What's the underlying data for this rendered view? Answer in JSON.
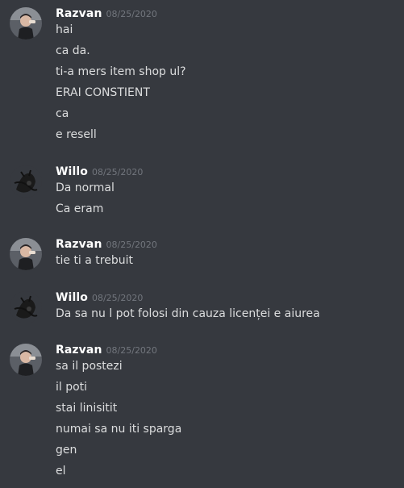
{
  "colors": {
    "background": "#36393f",
    "username": "#ffffff",
    "timestamp": "#72767d",
    "message_text": "#dcddde"
  },
  "messages": [
    {
      "author": "Razvan",
      "avatar_icon": "razvan-avatar-icon",
      "timestamp": "08/25/2020",
      "lines": [
        "hai",
        "ca da.",
        "ti-a mers item shop ul?",
        "ERAI CONSTIENT",
        "ca",
        "e resell"
      ]
    },
    {
      "author": "Willo",
      "avatar_icon": "willo-avatar-icon",
      "timestamp": "08/25/2020",
      "lines": [
        "Da normal",
        "Ca eram"
      ]
    },
    {
      "author": "Razvan",
      "avatar_icon": "razvan-avatar-icon",
      "timestamp": "08/25/2020",
      "lines": [
        "tie ti a trebuit"
      ]
    },
    {
      "author": "Willo",
      "avatar_icon": "willo-avatar-icon",
      "timestamp": "08/25/2020",
      "lines": [
        "Da sa nu l pot folosi din cauza licenței e aiurea"
      ]
    },
    {
      "author": "Razvan",
      "avatar_icon": "razvan-avatar-icon",
      "timestamp": "08/25/2020",
      "lines": [
        "sa il postezi",
        "il poti",
        "stai linisitit",
        "numai sa nu iti sparga",
        "gen",
        "el"
      ]
    }
  ]
}
